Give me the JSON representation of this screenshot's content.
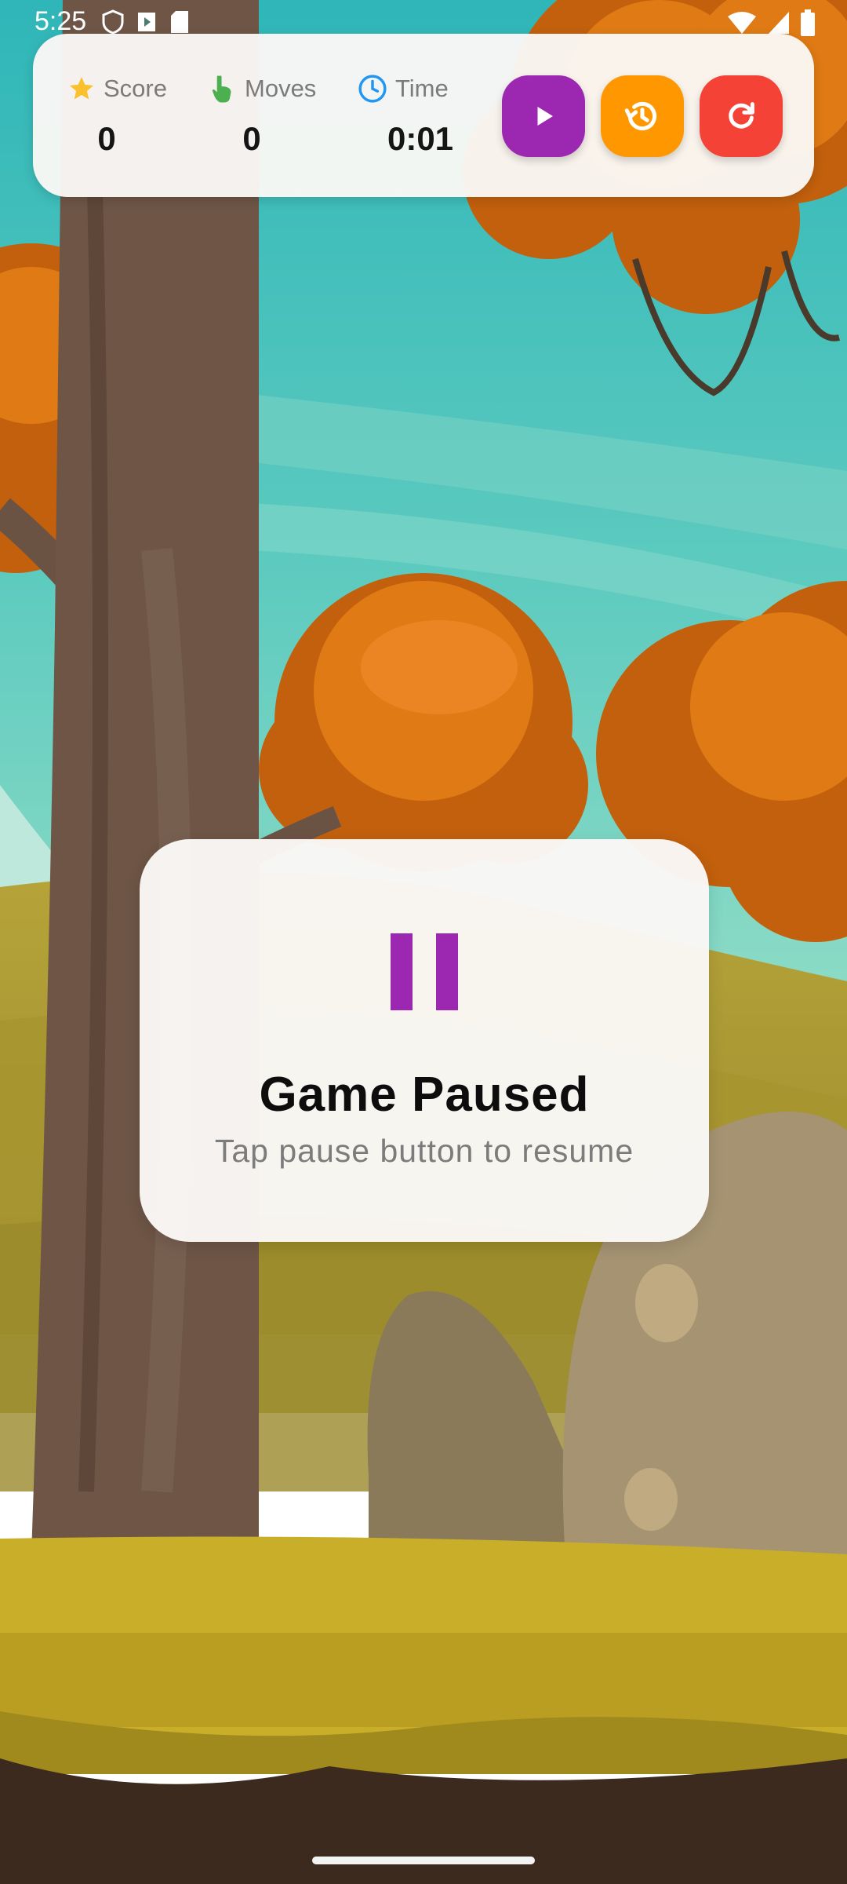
{
  "status_bar": {
    "time": "5:25"
  },
  "hud": {
    "score": {
      "label": "Score",
      "value": "0",
      "icon": "star-icon"
    },
    "moves": {
      "label": "Moves",
      "value": "0",
      "icon": "hand-pointer-icon"
    },
    "time": {
      "label": "Time",
      "value": "0:01",
      "icon": "clock-icon"
    },
    "buttons": [
      {
        "name": "play-button",
        "icon": "play-icon",
        "color": "#9C27B0"
      },
      {
        "name": "history-button",
        "icon": "history-icon",
        "color": "#FF9800"
      },
      {
        "name": "restart-button",
        "icon": "refresh-icon",
        "color": "#F44336"
      }
    ]
  },
  "pause_overlay": {
    "title": "Game Paused",
    "subtitle": "Tap pause button to resume",
    "icon": "pause-icon",
    "icon_color": "#9C27B0"
  }
}
